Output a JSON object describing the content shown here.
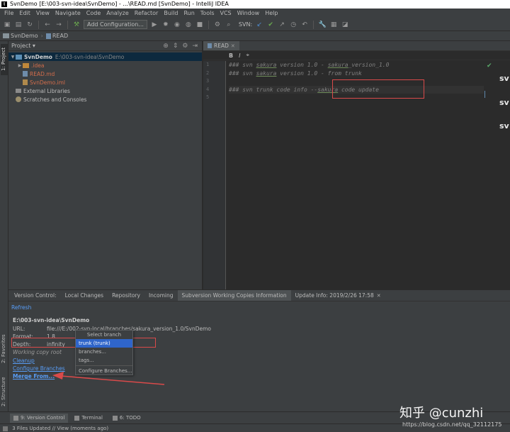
{
  "window": {
    "title": "SvnDemo [E:\\003-svn-idea\\SvnDemo] - ...\\READ.md [SvnDemo] - IntelliJ IDEA"
  },
  "menu": [
    "File",
    "Edit",
    "View",
    "Navigate",
    "Code",
    "Analyze",
    "Refactor",
    "Build",
    "Run",
    "Tools",
    "VCS",
    "Window",
    "Help"
  ],
  "toolbar": {
    "config_label": "Add Configuration...",
    "svn_label": "SVN:"
  },
  "breadcrumb": [
    "SvnDemo",
    "READ"
  ],
  "left_strip": {
    "project_tab": "1: Project",
    "favorites_tab": "2: Favorites",
    "structure_tab": "2: Structure"
  },
  "project_panel": {
    "title": "Project ▾",
    "root_name": "SvnDemo",
    "root_path": "E:\\003-svn-idea\\SvnDemo",
    "items": [
      ".idea",
      "READ.md",
      "SvnDemo.iml"
    ],
    "external_libs": "External Libraries",
    "scratches": "Scratches and Consoles"
  },
  "editor": {
    "tab_label": "READ",
    "bold_btn": "B",
    "italic_btn": "I",
    "line_numbers": [
      "1",
      "2",
      "3",
      "4",
      "5"
    ],
    "lines": {
      "l1_a": "### svn ",
      "l1_b": "sakura",
      "l1_c": " version 1.0 - ",
      "l1_d": "sakura",
      "l1_e": "_version_1.0",
      "l2_a": "### svn ",
      "l2_b": "sakura",
      "l2_c": " version 1.0 - from trunk",
      "l4_a": "### svn trunk code info --",
      "l4_b": "sakura",
      "l4_c": " code update"
    },
    "right_crop": [
      "sv",
      "sv",
      "sv"
    ]
  },
  "bottom_panel": {
    "tabs": [
      "Version Control:",
      "Local Changes",
      "Repository",
      "Incoming",
      "Subversion Working Copies Information",
      "Update Info: 2019/2/26 17:58"
    ],
    "refresh": "Refresh",
    "wc_root": "E:\\003-svn-idea\\SvnDemo",
    "url_key": "URL:",
    "url_val": "file:///E:/002-svn-local/branches/sakura_version_1.0/SvnDemo",
    "format_key": "Format:",
    "format_val": "1.8",
    "depth_key": "Depth:",
    "depth_val": "infinity",
    "working_copy_root": "Working copy root",
    "cleanup": "Cleanup",
    "configure_branches": "Configure Branches",
    "merge_from": "Merge From..."
  },
  "popup": {
    "title": "Select branch",
    "items": [
      "trunk (trunk)",
      "branches...",
      "tags...",
      "Configure Branches..."
    ]
  },
  "bottom_tabs": [
    "9: Version Control",
    "Terminal",
    "6: TODO"
  ],
  "status": "3 Files Updated // View (moments ago)",
  "watermark": {
    "text": "知乎 @cunzhi",
    "url": "https://blog.csdn.net/qq_32112175"
  },
  "colors": {
    "annotation_red": "#d94a4a",
    "link_blue": "#589df6",
    "selection_blue": "#2f65ca"
  }
}
